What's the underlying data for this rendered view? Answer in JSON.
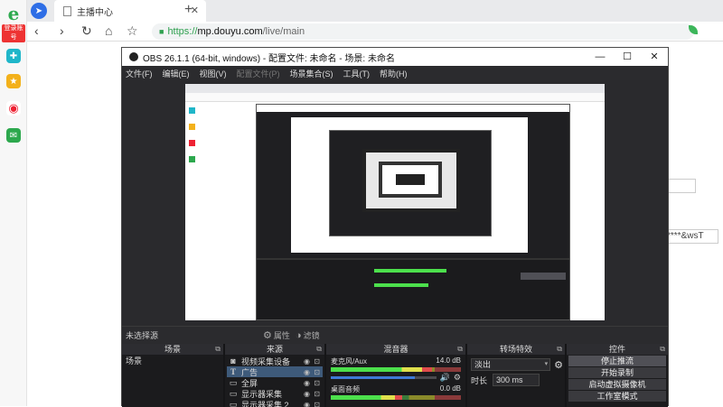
{
  "browser": {
    "tab_title": "主播中心",
    "url_scheme": "https://",
    "url_host": "mp.douyu.com",
    "url_path": "/live/main",
    "login_badge": "登录账号",
    "brand_letter": "e",
    "accent_partial": "–",
    "bg_field_text": "****&wsT"
  },
  "obs": {
    "title": "OBS 26.1.1 (64-bit, windows) - 配置文件: 未命名 - 场景: 未命名",
    "menu": [
      "文件(F)",
      "编辑(E)",
      "视图(V)",
      "配置文件(P)",
      "场景集合(S)",
      "工具(T)",
      "帮助(H)"
    ],
    "no_source_label": "未选择源",
    "properties_label": "属性",
    "filters_label": "滤镜",
    "docks": {
      "scenes": {
        "title": "场景",
        "items": [
          "场景"
        ]
      },
      "sources": {
        "title": "来源",
        "items": [
          {
            "icon": "camera-icon",
            "label": "视频采集设备"
          },
          {
            "icon": "text-icon",
            "label": "广告"
          },
          {
            "icon": "monitor-icon",
            "label": "全屏"
          },
          {
            "icon": "monitor-icon",
            "label": "显示器采集"
          },
          {
            "icon": "monitor-icon",
            "label": "显示器采集 2"
          }
        ]
      },
      "mixer": {
        "title": "混音器",
        "channels": [
          {
            "name": "麦克风/Aux",
            "db": "14.0 dB",
            "level": 0.78,
            "volume": 0.8
          },
          {
            "name": "桌面音频",
            "db": "0.0 dB",
            "level": 0.55,
            "volume": 0.85
          }
        ]
      },
      "transitions": {
        "title": "转场特效",
        "selected": "淡出",
        "duration_label": "时长",
        "duration_value": "300 ms"
      },
      "controls": {
        "title": "控件",
        "buttons": [
          "停止推流",
          "开始录制",
          "启动虚拟摄像机",
          "工作室模式"
        ]
      }
    }
  }
}
